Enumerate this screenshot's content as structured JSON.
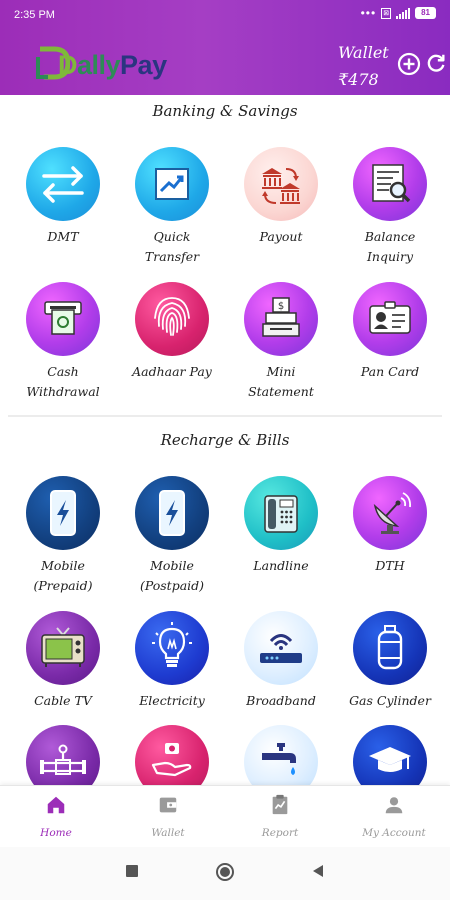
{
  "status": {
    "time": "2:35 PM",
    "battery": "81"
  },
  "header": {
    "logo_text": "DallyPay",
    "wallet_label": "Wallet",
    "wallet_amount": "₹478"
  },
  "sections": [
    {
      "title": "Banking & Savings",
      "items": [
        {
          "label": "DMT",
          "icon": "transfer-arrows-icon",
          "color": "#1fa8e8"
        },
        {
          "label": "Quick\nTransfer",
          "icon": "chart-up-icon",
          "color": "#1fa8e8"
        },
        {
          "label": "Payout",
          "icon": "bank-exchange-icon",
          "color": "#fbd6d2"
        },
        {
          "label": "Balance\nInquiry",
          "icon": "document-search-icon",
          "color": "#b23dea"
        },
        {
          "label": "Cash\nWithdrawal",
          "icon": "atm-cash-icon",
          "color": "#b23dea"
        },
        {
          "label": "Aadhaar Pay",
          "icon": "fingerprint-icon",
          "color": "#d8236e"
        },
        {
          "label": "Mini\nStatement",
          "icon": "cash-register-icon",
          "color": "#b23dea"
        },
        {
          "label": "Pan Card",
          "icon": "id-card-icon",
          "color": "#b23dea"
        }
      ]
    },
    {
      "title": "Recharge & Bills",
      "items": [
        {
          "label": "Mobile\n(Prepaid)",
          "icon": "mobile-charge-icon",
          "color": "#12407f"
        },
        {
          "label": "Mobile\n(Postpaid)",
          "icon": "mobile-charge-icon",
          "color": "#12407f"
        },
        {
          "label": "Landline",
          "icon": "landline-phone-icon",
          "color": "#1fbfc7"
        },
        {
          "label": "DTH",
          "icon": "satellite-dish-icon",
          "color": "#b23dea"
        },
        {
          "label": "Cable TV",
          "icon": "tv-icon",
          "color": "#7a2aa8"
        },
        {
          "label": "Electricity",
          "icon": "lightbulb-icon",
          "color": "#1e3bd0"
        },
        {
          "label": "Broadband",
          "icon": "router-icon",
          "color": "#dfefff"
        },
        {
          "label": "Gas Cylinder",
          "icon": "gas-cylinder-icon",
          "color": "#1535b8"
        },
        {
          "label": "",
          "icon": "pipeline-icon",
          "color": "#7a2aa8"
        },
        {
          "label": "",
          "icon": "insurance-hand-icon",
          "color": "#d8236e"
        },
        {
          "label": "",
          "icon": "water-tap-icon",
          "color": "#dfefff"
        },
        {
          "label": "",
          "icon": "graduation-cap-icon",
          "color": "#1535b8"
        }
      ]
    }
  ],
  "bottom_nav": [
    {
      "label": "Home",
      "icon": "home-icon",
      "active": true
    },
    {
      "label": "Wallet",
      "icon": "wallet-icon",
      "active": false
    },
    {
      "label": "Report",
      "icon": "report-icon",
      "active": false
    },
    {
      "label": "My Account",
      "icon": "person-icon",
      "active": false
    }
  ],
  "colors": {
    "brand": "#9c2db8",
    "active_nav": "#9c2db8",
    "inactive_nav": "#9a9a9a"
  }
}
